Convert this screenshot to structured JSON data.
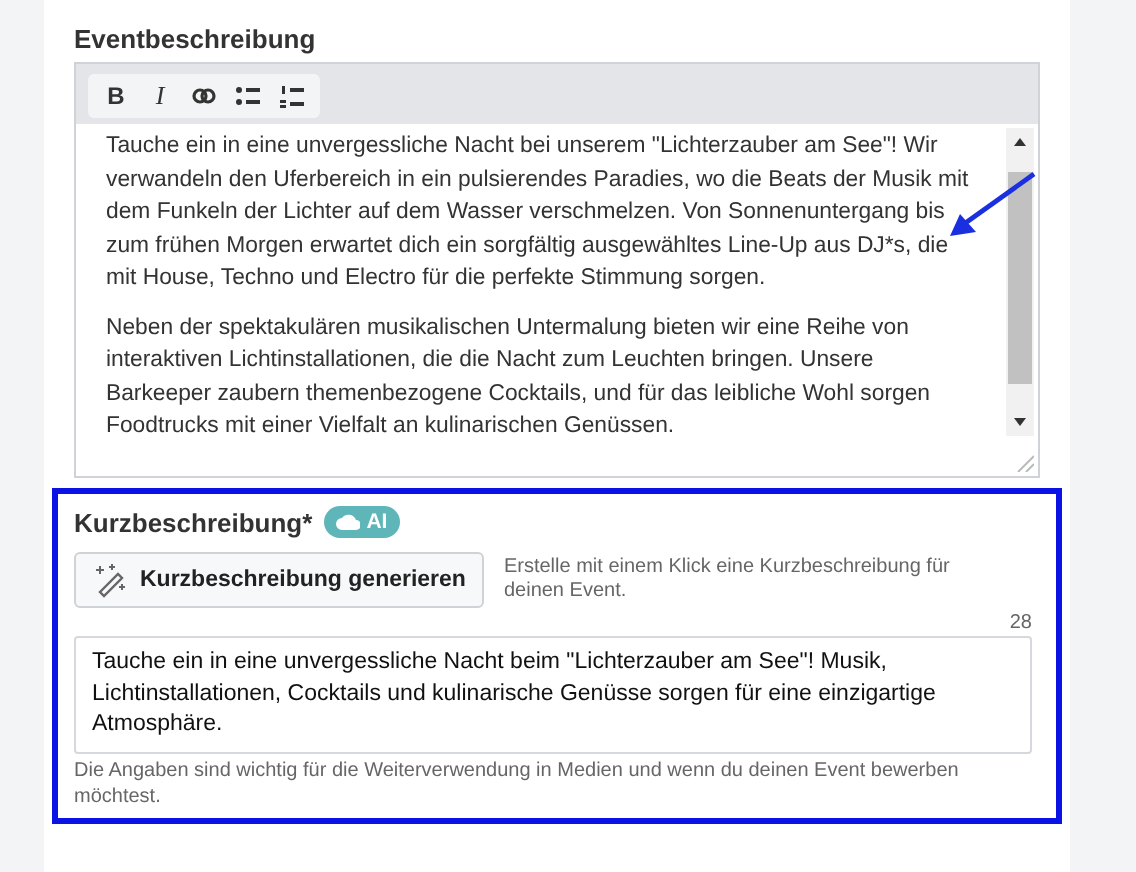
{
  "event_description": {
    "label": "Eventbeschreibung",
    "toolbar": [
      {
        "kind": "bold",
        "label": "B"
      },
      {
        "kind": "italic",
        "label": "I"
      },
      {
        "kind": "link"
      },
      {
        "kind": "bullets"
      },
      {
        "kind": "numbered"
      }
    ],
    "paragraphs": [
      "Tauche ein in eine unvergessliche Nacht bei unserem \"Lichterzauber am See\"! Wir verwandeln den Uferbereich in ein pulsierendes Paradies, wo die Beats der Musik mit dem Funkeln der Lichter auf dem Wasser verschmelzen. Von Sonnenuntergang bis zum frühen Morgen erwartet dich ein sorgfältig ausgewähltes Line-Up aus DJ*s, die mit House, Techno und Electro für die perfekte Stimmung sorgen.",
      "Neben der spektakulären musikalischen Untermalung bieten wir eine Reihe von interaktiven Lichtinstallationen, die die Nacht zum Leuchten bringen. Unsere Barkeeper zaubern themenbezogene Cocktails, und für das leibliche Wohl sorgen Foodtrucks mit einer Vielfalt an kulinarischen Genüssen."
    ]
  },
  "short_description": {
    "label": "Kurzbeschreibung*",
    "badge": "AI",
    "generate_button": "Kurzbeschreibung generieren",
    "hint": "Erstelle mit einem Klick eine Kurzbeschreibung für deinen Event.",
    "counter": "28",
    "value": "Tauche ein in eine unvergessliche Nacht beim \"Lichterzauber am See\"! Musik, Lichtinstallationen, Cocktails und kulinarische Genüsse sorgen für eine einzigartige Atmosphäre.",
    "help": "Die Angaben sind wichtig für die Weiterverwendung in Medien und wenn du deinen Event bewerben möchtest."
  }
}
